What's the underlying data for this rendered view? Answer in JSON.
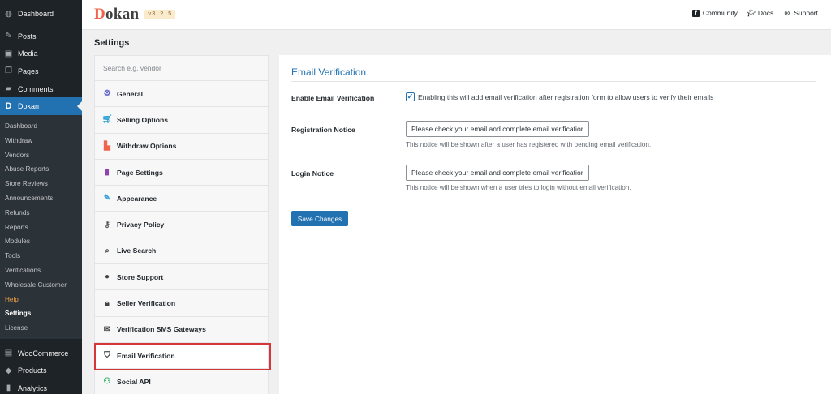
{
  "admin_menu": {
    "top_items": [
      {
        "label": "Dashboard",
        "icon": "dashboard-icon"
      },
      {
        "label": "Posts",
        "icon": "pin-icon"
      },
      {
        "label": "Media",
        "icon": "media-icon"
      },
      {
        "label": "Pages",
        "icon": "pages-icon"
      },
      {
        "label": "Comments",
        "icon": "comments-icon"
      },
      {
        "label": "Dokan",
        "icon": "dokan-icon"
      }
    ],
    "dokan_submenu": [
      "Dashboard",
      "Withdraw",
      "Vendors",
      "Abuse Reports",
      "Store Reviews",
      "Announcements",
      "Refunds",
      "Reports",
      "Modules",
      "Tools",
      "Verifications",
      "Wholesale Customer",
      "Help",
      "Settings",
      "License"
    ],
    "bottom_items": [
      {
        "label": "WooCommerce",
        "icon": "woocommerce-icon"
      },
      {
        "label": "Products",
        "icon": "products-icon"
      },
      {
        "label": "Analytics",
        "icon": "analytics-icon"
      }
    ]
  },
  "header": {
    "logo": "Dokan",
    "version": "v3.2.5",
    "links": [
      {
        "label": "Community",
        "icon": "facebook-icon"
      },
      {
        "label": "Docs",
        "icon": "graduation-cap-icon"
      },
      {
        "label": "Support",
        "icon": "lifebuoy-icon"
      }
    ]
  },
  "page_title": "Settings",
  "settings_nav": {
    "search_placeholder": "Search e.g. vendor",
    "items": [
      {
        "label": "General",
        "icon": "gear-icon"
      },
      {
        "label": "Selling Options",
        "icon": "cart-icon"
      },
      {
        "label": "Withdraw Options",
        "icon": "withdraw-icon"
      },
      {
        "label": "Page Settings",
        "icon": "page-icon"
      },
      {
        "label": "Appearance",
        "icon": "brush-icon"
      },
      {
        "label": "Privacy Policy",
        "icon": "key-icon"
      },
      {
        "label": "Live Search",
        "icon": "search-icon"
      },
      {
        "label": "Store Support",
        "icon": "chat-icon"
      },
      {
        "label": "Seller Verification",
        "icon": "lock-icon"
      },
      {
        "label": "Verification SMS Gateways",
        "icon": "envelope-icon"
      },
      {
        "label": "Email Verification",
        "icon": "shield-icon"
      },
      {
        "label": "Social API",
        "icon": "network-icon"
      }
    ],
    "active": "Email Verification"
  },
  "panel": {
    "title": "Email Verification",
    "enable_label": "Enable Email Verification",
    "enable_checked": true,
    "enable_text": "Enabling this will add email verification after registration form to allow users to verify their emails",
    "registration_label": "Registration Notice",
    "registration_value": "Please check your email and complete email verification",
    "registration_desc": "This notice will be shown after a user has registered with pending email verification.",
    "login_label": "Login Notice",
    "login_value": "Please check your email and complete email verification",
    "login_desc": "This notice will be shown when a user tries to login without email verification.",
    "save_label": "Save Changes"
  },
  "colors": {
    "accent": "#2271b1",
    "sidebar_bg": "#1d2327",
    "highlight_border": "#d63638",
    "brand": "#f1634c"
  }
}
